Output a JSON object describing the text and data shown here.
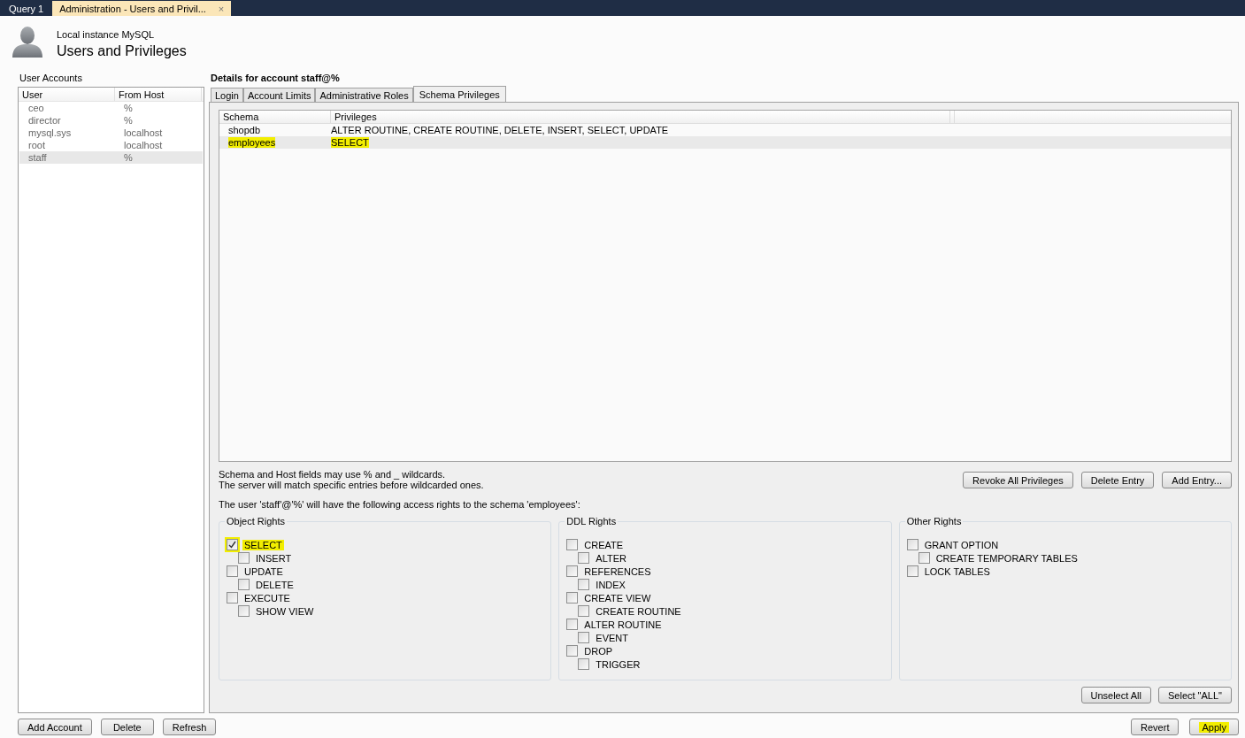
{
  "doc_tabs": [
    {
      "label": "Query 1",
      "selected": false
    },
    {
      "label": "Administration - Users and Privil...",
      "selected": true,
      "close_glyph": "×"
    }
  ],
  "header": {
    "subtitle": "Local instance MySQL",
    "title": "Users and Privileges"
  },
  "user_accounts": {
    "label": "User Accounts",
    "columns": [
      "User",
      "From Host"
    ],
    "rows": [
      {
        "user": "ceo",
        "host": "%",
        "selected": false
      },
      {
        "user": "director",
        "host": "%",
        "selected": false
      },
      {
        "user": "mysql.sys",
        "host": "localhost",
        "selected": false
      },
      {
        "user": "root",
        "host": "localhost",
        "selected": false
      },
      {
        "user": "staff",
        "host": "%",
        "selected": true
      }
    ],
    "buttons": [
      "Add Account",
      "Delete",
      "Refresh"
    ]
  },
  "details": {
    "title": "Details for account staff@%",
    "tabs": [
      {
        "label": "Login",
        "selected": false
      },
      {
        "label": "Account Limits",
        "selected": false
      },
      {
        "label": "Administrative Roles",
        "selected": false
      },
      {
        "label": "Schema Privileges",
        "selected": true
      }
    ],
    "schema_table": {
      "columns": [
        "Schema",
        "Privileges"
      ],
      "rows": [
        {
          "schema": "shopdb",
          "privileges": "ALTER ROUTINE, CREATE ROUTINE, DELETE, INSERT, SELECT, UPDATE",
          "selected": false,
          "highlighted": false
        },
        {
          "schema": "employees",
          "privileges": "SELECT",
          "selected": true,
          "highlighted": true
        }
      ]
    },
    "notes": [
      "Schema and Host fields may use % and _ wildcards.",
      "The server will match specific entries before wildcarded ones."
    ],
    "entry_buttons": [
      "Revoke All Privileges",
      "Delete Entry",
      "Add Entry..."
    ],
    "access_text": "The user 'staff'@'%' will have the following access rights to the schema 'employees':",
    "groups": [
      {
        "title": "Object Rights",
        "items": [
          {
            "label": "SELECT",
            "checked": true,
            "highlighted": true,
            "children": [
              {
                "label": "INSERT",
                "checked": false,
                "highlighted": false
              }
            ]
          },
          {
            "label": "UPDATE",
            "checked": false,
            "highlighted": false,
            "children": [
              {
                "label": "DELETE",
                "checked": false,
                "highlighted": false
              }
            ]
          },
          {
            "label": "EXECUTE",
            "checked": false,
            "highlighted": false,
            "children": [
              {
                "label": "SHOW VIEW",
                "checked": false,
                "highlighted": false
              }
            ]
          }
        ]
      },
      {
        "title": "DDL Rights",
        "items": [
          {
            "label": "CREATE",
            "checked": false,
            "highlighted": false,
            "children": [
              {
                "label": "ALTER",
                "checked": false,
                "highlighted": false
              }
            ]
          },
          {
            "label": "REFERENCES",
            "checked": false,
            "highlighted": false,
            "children": [
              {
                "label": "INDEX",
                "checked": false,
                "highlighted": false
              }
            ]
          },
          {
            "label": "CREATE VIEW",
            "checked": false,
            "highlighted": false,
            "children": [
              {
                "label": "CREATE ROUTINE",
                "checked": false,
                "highlighted": false
              }
            ]
          },
          {
            "label": "ALTER ROUTINE",
            "checked": false,
            "highlighted": false,
            "children": [
              {
                "label": "EVENT",
                "checked": false,
                "highlighted": false
              }
            ]
          },
          {
            "label": "DROP",
            "checked": false,
            "highlighted": false,
            "children": [
              {
                "label": "TRIGGER",
                "checked": false,
                "highlighted": false
              }
            ]
          }
        ]
      },
      {
        "title": "Other Rights",
        "items": [
          {
            "label": "GRANT OPTION",
            "checked": false,
            "highlighted": false,
            "children": [
              {
                "label": "CREATE TEMPORARY TABLES",
                "checked": false,
                "highlighted": false
              }
            ]
          },
          {
            "label": "LOCK TABLES",
            "checked": false,
            "highlighted": false
          }
        ]
      }
    ],
    "select_buttons": [
      "Unselect All",
      "Select \"ALL\""
    ]
  },
  "footer_buttons": [
    {
      "label": "Revert",
      "highlighted": false
    },
    {
      "label": "Apply",
      "highlighted": true
    }
  ]
}
